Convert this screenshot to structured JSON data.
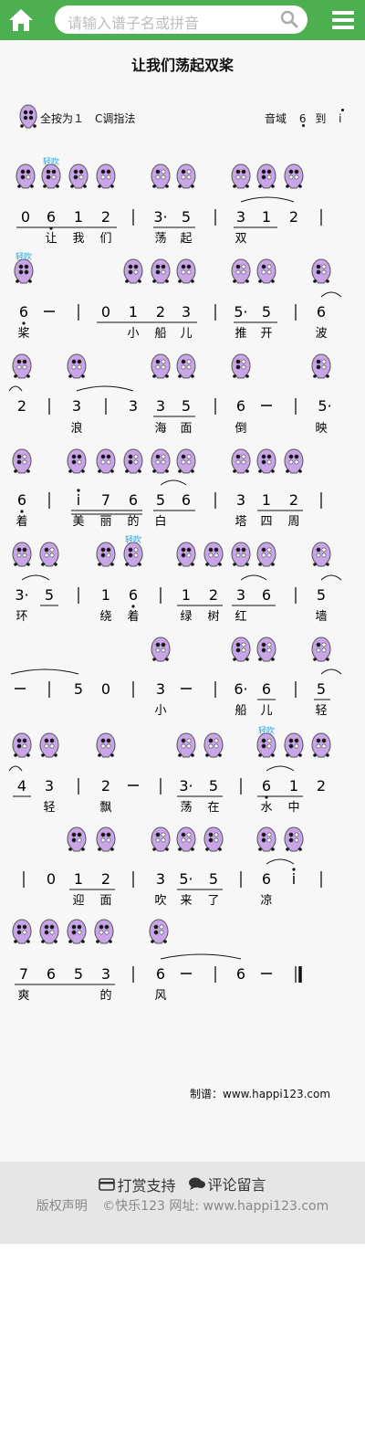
{
  "header": {
    "search_placeholder": "请输入谱子名或拼音",
    "icons": [
      "home-icon",
      "search-icon",
      "menu-icon"
    ]
  },
  "score": {
    "title": "让我们荡起双桨",
    "fingering_note": "全按为１　C调指法",
    "range_label": "音域",
    "range_from": "6",
    "range_to_word": "到",
    "range_to": "i",
    "breath_mark": "轻吹",
    "maker": "制谱：www.happi123.com",
    "colors": {
      "ocarina_fill": "#c8a4e8",
      "ocarina_stroke": "#555",
      "breath": "#1ea0e6",
      "green": "#4caf50"
    }
  },
  "lyrics": {
    "r1": [
      "让",
      "我",
      "们",
      "荡",
      "起",
      "双"
    ],
    "r2": [
      "桨",
      "小",
      "船",
      "儿",
      "推",
      "开",
      "波"
    ],
    "r3": [
      "浪",
      "海",
      "面",
      "倒",
      "映"
    ],
    "r4": [
      "着",
      "美",
      "丽",
      "的",
      "白",
      "塔",
      "四",
      "周"
    ],
    "r5": [
      "环",
      "绕",
      "着",
      "绿",
      "树",
      "红",
      "墙"
    ],
    "r6": [
      "小",
      "船",
      "儿",
      "轻"
    ],
    "r7": [
      "轻",
      "飘",
      "荡",
      "在",
      "水",
      "中"
    ],
    "r8": [
      "迎",
      "面",
      "吹",
      "来",
      "了",
      "凉"
    ],
    "r9": [
      "爽",
      "的",
      "风"
    ]
  },
  "footer": {
    "reward": "打赏支持",
    "comment": "评论留言",
    "copyright": "版权声明",
    "site": "©快乐123 网址: www.happi123.com"
  }
}
